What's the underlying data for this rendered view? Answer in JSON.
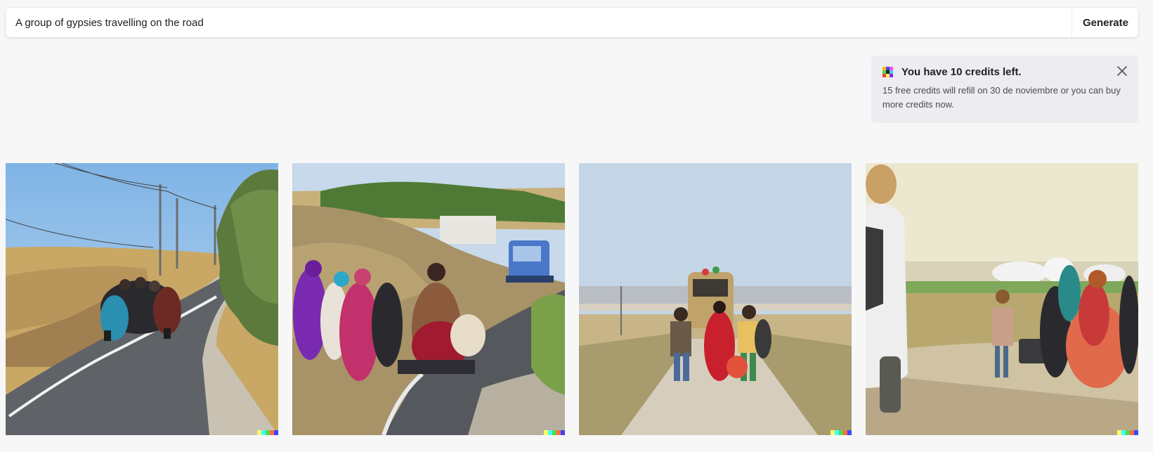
{
  "search": {
    "value": "A group of gypsies travelling on the road",
    "button_label": "Generate"
  },
  "toast": {
    "title": "You have 10 credits left.",
    "message": "15 free credits will refill on 30 de noviembre or you can buy more credits now."
  },
  "colors": {
    "background": "#f7f7f8",
    "watermark": [
      "#ffff66",
      "#42ffff",
      "#51da4c",
      "#ff6e3c",
      "#3c46ff"
    ]
  },
  "images": [
    {
      "subject": "group with bundles walking on a curving rural road under power lines"
    },
    {
      "subject": "people in colorful clothing pushing carts along a road, van approaching"
    },
    {
      "subject": "people walking on a dirt road toward a loaded van"
    },
    {
      "subject": "women in colorful dresses carrying bags beside a white vehicle"
    }
  ]
}
